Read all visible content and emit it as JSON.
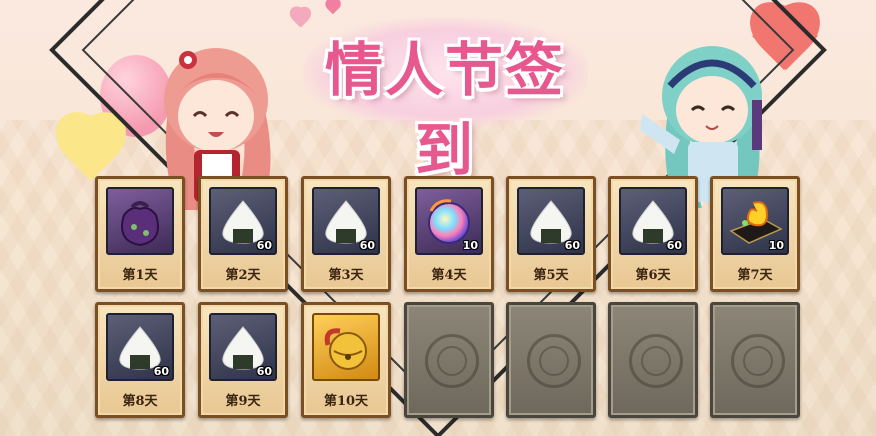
{
  "event": {
    "title": "情人节签到"
  },
  "days": [
    {
      "label": "第1天",
      "item_icon": "lucky-bag-icon",
      "quantity": null,
      "claimed": true
    },
    {
      "label": "第2天",
      "item_icon": "rice-ball-icon",
      "quantity": "60",
      "claimed": true
    },
    {
      "label": "第3天",
      "item_icon": "rice-ball-icon",
      "quantity": "60",
      "claimed": true
    },
    {
      "label": "第4天",
      "item_icon": "rainbow-orb-icon",
      "quantity": "10",
      "claimed": true
    },
    {
      "label": "第5天",
      "item_icon": "rice-ball-icon",
      "quantity": "60",
      "claimed": true
    },
    {
      "label": "第6天",
      "item_icon": "rice-ball-icon",
      "quantity": "60",
      "claimed": true
    },
    {
      "label": "第7天",
      "item_icon": "magatama-box-icon",
      "quantity": "10",
      "claimed": true
    },
    {
      "label": "第8天",
      "item_icon": "rice-ball-icon",
      "quantity": "60",
      "claimed": true
    },
    {
      "label": "第9天",
      "item_icon": "rice-ball-icon",
      "quantity": "60",
      "claimed": true
    },
    {
      "label": "第10天",
      "item_icon": "golden-bell-icon",
      "quantity": null,
      "claimed": true
    },
    {
      "label": null,
      "item_icon": "locked-emblem-icon",
      "quantity": null,
      "claimed": false
    },
    {
      "label": null,
      "item_icon": "locked-emblem-icon",
      "quantity": null,
      "claimed": false
    },
    {
      "label": null,
      "item_icon": "locked-emblem-icon",
      "quantity": null,
      "claimed": false
    },
    {
      "label": null,
      "item_icon": "locked-emblem-icon",
      "quantity": null,
      "claimed": false
    }
  ],
  "colors": {
    "title_pink": "#e7588f",
    "card_border": "#7a4f24",
    "locked_card": "#7a7468"
  }
}
